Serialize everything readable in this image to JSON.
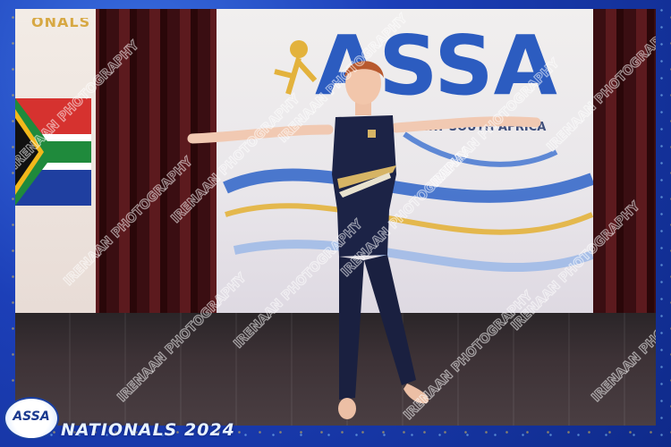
{
  "banner": {
    "logo_text": "ASSA",
    "subtitle": "...RT SOUTH AFRICA",
    "corner_text": "ONALS"
  },
  "watermark": {
    "text": "IRENAAN PHOTOGRAPHY"
  },
  "footer": {
    "badge_text": "ASSA",
    "event_title": "NATIONALS 2024"
  },
  "colors": {
    "frame_blue": "#1c3fb8",
    "gold_accent": "#d7a843",
    "leotard_navy": "#1c2346"
  }
}
